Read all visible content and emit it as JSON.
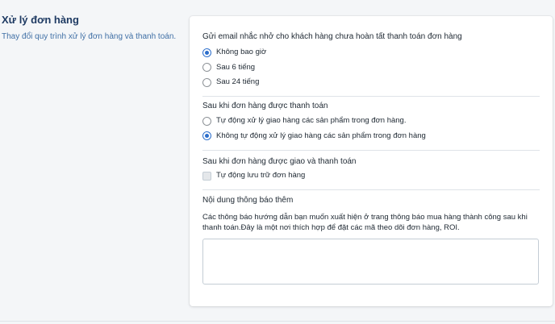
{
  "section": {
    "title": "Xử lý đơn hàng",
    "description": "Thay đổi quy trình xử lý đơn hàng và thanh toán."
  },
  "reminder": {
    "title": "Gửi email nhắc nhở cho khách hàng chưa hoàn tất thanh toán đơn hàng",
    "options": [
      {
        "label": "Không bao giờ",
        "checked": true
      },
      {
        "label": "Sau 6 tiếng",
        "checked": false
      },
      {
        "label": "Sau 24 tiếng",
        "checked": false
      }
    ]
  },
  "after_paid": {
    "title": "Sau khi đơn hàng được thanh toán",
    "options": [
      {
        "label": "Tự động xử lý giao hàng các sản phẩm trong đơn hàng.",
        "checked": false
      },
      {
        "label": "Không tự động xử lý giao hàng các sản phẩm trong đơn hàng",
        "checked": true
      }
    ]
  },
  "after_delivered": {
    "title": "Sau khi đơn hàng được giao và thanh toán",
    "checkbox_label": "Tự động lưu trữ đơn hàng",
    "checked": false
  },
  "extra_notice": {
    "title": "Nội dung thông báo thêm",
    "description": "Các thông báo hướng dẫn bạn muốn xuất hiện ở trang thông báo mua hàng thành công sau khi thanh toán.Đây là một nơi thích hợp để đặt các mã theo dõi đơn hàng, ROI.",
    "value": ""
  },
  "colors": {
    "accent": "#2c6ecb",
    "title": "#1f3b63",
    "description": "#3f6fa5"
  }
}
